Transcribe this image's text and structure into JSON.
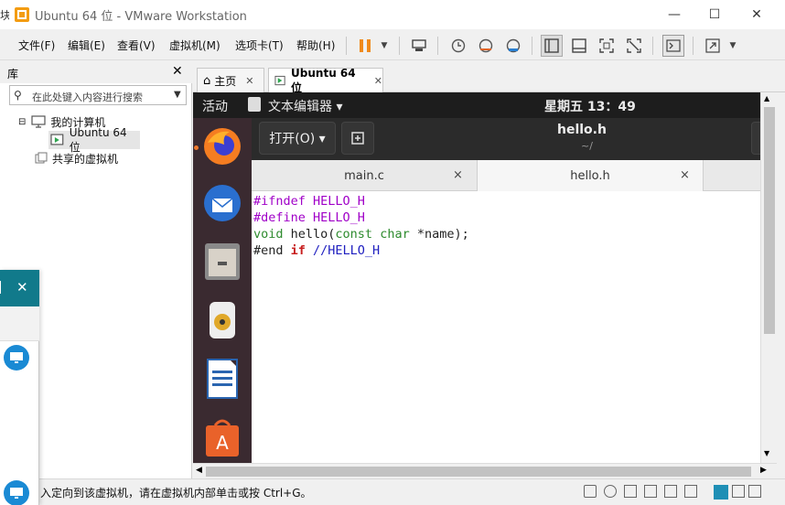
{
  "window": {
    "title": "Ubuntu 64 位 - VMware Workstation",
    "edge_glyph": "块",
    "minimize_label": "—",
    "maximize_label": "☐",
    "close_label": "✕"
  },
  "menu": {
    "items": [
      "文件(F)",
      "编辑(E)",
      "查看(V)",
      "虚拟机(M)",
      "选项卡(T)",
      "帮助(H)"
    ]
  },
  "library": {
    "title": "库",
    "close_label": "✕",
    "search_placeholder": "在此处键入内容进行搜索",
    "tree": {
      "my_computer": "我的计算机",
      "vm_item": "Ubuntu 64 位",
      "shared": "共享的虚拟机"
    }
  },
  "tabs": [
    {
      "label": "主页",
      "close": "✕"
    },
    {
      "label": "Ubuntu 64 位",
      "close": "✕"
    }
  ],
  "guest": {
    "activities": "活动",
    "app_menu": "文本编辑器 ▾",
    "clock": "星期五 13：49",
    "open_button": "打开(O) ▾",
    "header_title": "hello.h",
    "header_subtitle": "~/",
    "editor_tabs": [
      {
        "label": "main.c",
        "close": "×"
      },
      {
        "label": "hello.h",
        "close": "×"
      }
    ]
  },
  "code": {
    "line1_pp": "#ifndef",
    "line1_rest": " HELLO_H",
    "line2_pp": "#define",
    "line2_rest": " HELLO_H",
    "line3_void": "void",
    "line3_mid": " hello(",
    "line3_const": "const",
    "line3_sp": " ",
    "line3_char": "char",
    "line3_rest": " *name);",
    "line4_end": "#end",
    "line4_if": " if",
    "line4_comment": " //HELLO_H"
  },
  "status": {
    "message": "入定向到该虚拟机，请在虚拟机内部单击或按 Ctrl+G。"
  },
  "colors": {
    "teal_panel": "#117a8b",
    "dock": "#3a2a30",
    "gnome_topbar": "#1d1d1d"
  }
}
